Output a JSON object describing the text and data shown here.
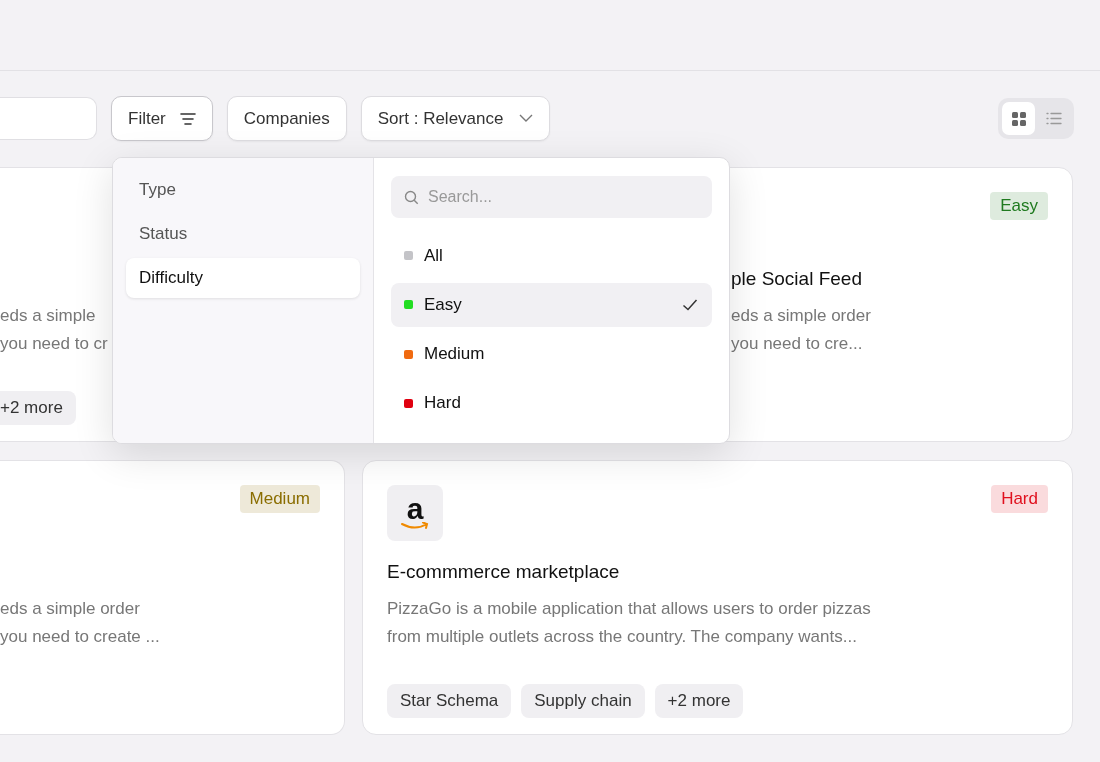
{
  "toolbar": {
    "filter_label": "Filter",
    "companies_label": "Companies",
    "sort_label": "Sort : Relevance",
    "views": [
      {
        "kind": "grid",
        "selected": true
      },
      {
        "kind": "list",
        "selected": false
      }
    ]
  },
  "cards": [
    {
      "lines": [
        "eds a simple",
        "you need to cr"
      ],
      "tags": [
        "+2 more"
      ]
    },
    {
      "badge": {
        "label": "Easy",
        "color": "#1f7a1f"
      },
      "title": "ple Social Feed",
      "lines": [
        "eds a simple order",
        "you need to cre..."
      ]
    },
    {
      "badge": {
        "label": "Medium",
        "color": "#8a6d00"
      },
      "lines": [
        "eds a simple order",
        "you need to create ..."
      ]
    },
    {
      "badge": {
        "label": "Hard",
        "color": "#e0101e"
      },
      "logo_letter": "a",
      "title": "E-commmerce marketplace",
      "lines": [
        "PizzaGo is a mobile application that allows users to order pizzas",
        "from  multiple outlets across the country. The company wants..."
      ],
      "tags": [
        "Star Schema",
        "Supply chain",
        "+2 more"
      ]
    }
  ],
  "filter_menu": {
    "categories": [
      {
        "label": "Type",
        "selected": false
      },
      {
        "label": "Status",
        "selected": false
      },
      {
        "label": "Difficulty",
        "selected": true
      }
    ],
    "search": {
      "placeholder": "Search..."
    },
    "options": [
      {
        "label": "All",
        "color": "#c4c4c8",
        "selected": false
      },
      {
        "label": "Easy",
        "color": "#22dd22",
        "selected": true
      },
      {
        "label": "Medium",
        "color": "#f06a10",
        "selected": false
      },
      {
        "label": "Hard",
        "color": "#e00010",
        "selected": false
      }
    ]
  }
}
